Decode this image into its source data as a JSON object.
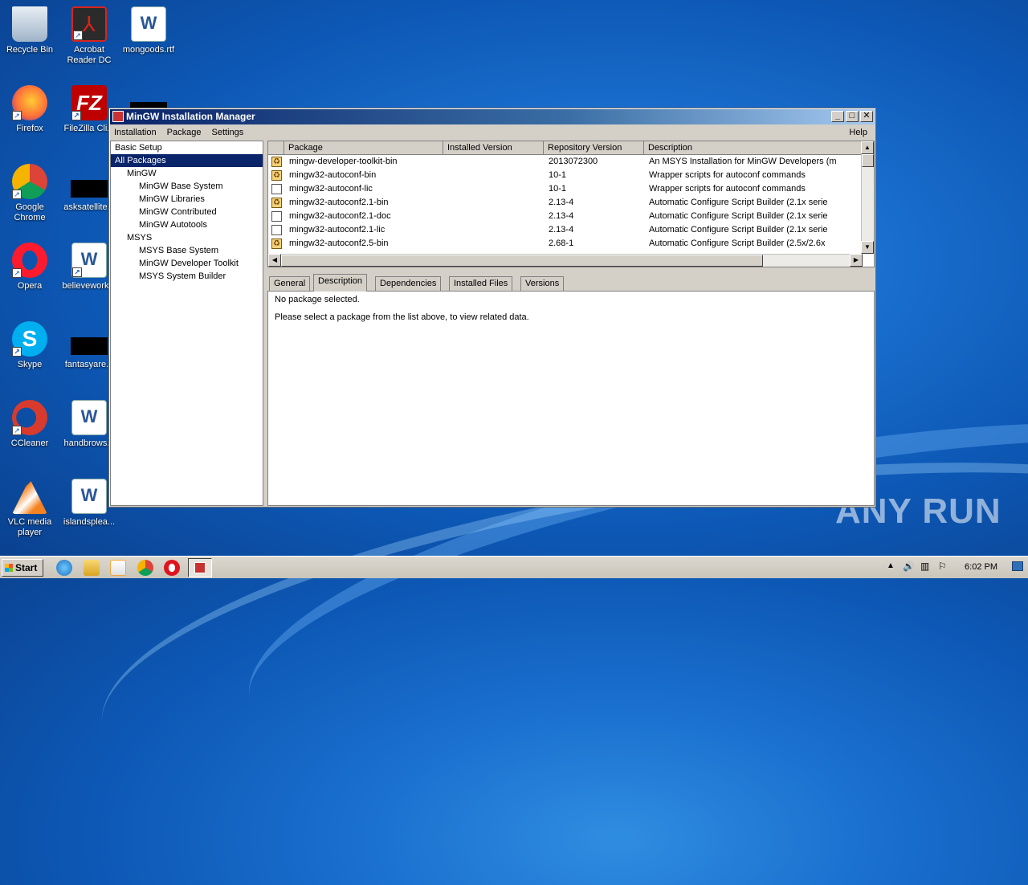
{
  "desktop": {
    "icons": [
      {
        "label": "Recycle Bin"
      },
      {
        "label": "Acrobat\nReader DC"
      },
      {
        "label": "mongoods.rtf"
      },
      {
        "label": "Firefox"
      },
      {
        "label": "FileZilla Cli..."
      },
      {
        "label": "Google\nChrome"
      },
      {
        "label": "asksatellite..."
      },
      {
        "label": "Opera"
      },
      {
        "label": "believework..."
      },
      {
        "label": "Skype"
      },
      {
        "label": "fantasyare..."
      },
      {
        "label": "CCleaner"
      },
      {
        "label": "handbrows..."
      },
      {
        "label": "VLC media\nplayer"
      },
      {
        "label": "islandsplea..."
      }
    ],
    "watermark": "ANY RUN"
  },
  "window": {
    "title": "MinGW Installation Manager",
    "menu": [
      "Installation",
      "Package",
      "Settings"
    ],
    "help": "Help",
    "tree": [
      {
        "label": "Basic Setup",
        "level": 0,
        "selected": false
      },
      {
        "label": "All Packages",
        "level": 0,
        "selected": true
      },
      {
        "label": "MinGW",
        "level": 1,
        "selected": false
      },
      {
        "label": "MinGW Base System",
        "level": 2,
        "selected": false
      },
      {
        "label": "MinGW Libraries",
        "level": 2,
        "selected": false
      },
      {
        "label": "MinGW Contributed",
        "level": 2,
        "selected": false
      },
      {
        "label": "MinGW Autotools",
        "level": 2,
        "selected": false
      },
      {
        "label": "MSYS",
        "level": 1,
        "selected": false
      },
      {
        "label": "MSYS Base System",
        "level": 2,
        "selected": false
      },
      {
        "label": "MinGW Developer Toolkit",
        "level": 2,
        "selected": false
      },
      {
        "label": "MSYS System Builder",
        "level": 2,
        "selected": false
      }
    ],
    "columns": [
      "Package",
      "Installed Version",
      "Repository Version",
      "Description"
    ],
    "packages": [
      {
        "package": "mingw-developer-toolkit-bin",
        "installed": "",
        "repo": "2013072300",
        "description": "An MSYS Installation for MinGW Developers (m",
        "icon": "install"
      },
      {
        "package": "mingw32-autoconf-bin",
        "installed": "",
        "repo": "10-1",
        "description": "Wrapper scripts for autoconf commands",
        "icon": "install"
      },
      {
        "package": "mingw32-autoconf-lic",
        "installed": "",
        "repo": "10-1",
        "description": "Wrapper scripts for autoconf commands",
        "icon": "empty"
      },
      {
        "package": "mingw32-autoconf2.1-bin",
        "installed": "",
        "repo": "2.13-4",
        "description": "Automatic Configure Script Builder (2.1x serie",
        "icon": "install"
      },
      {
        "package": "mingw32-autoconf2.1-doc",
        "installed": "",
        "repo": "2.13-4",
        "description": "Automatic Configure Script Builder (2.1x serie",
        "icon": "empty"
      },
      {
        "package": "mingw32-autoconf2.1-lic",
        "installed": "",
        "repo": "2.13-4",
        "description": "Automatic Configure Script Builder (2.1x serie",
        "icon": "empty"
      },
      {
        "package": "mingw32-autoconf2.5-bin",
        "installed": "",
        "repo": "2.68-1",
        "description": "Automatic Configure Script Builder (2.5x/2.6x",
        "icon": "install"
      }
    ],
    "tabs": [
      "General",
      "Description",
      "Dependencies",
      "Installed Files",
      "Versions"
    ],
    "active_tab": "Description",
    "detail": {
      "line1": "No package selected.",
      "line2": "Please select a package from the list above, to view related data."
    }
  },
  "taskbar": {
    "start": "Start",
    "clock": "6:02 PM"
  }
}
